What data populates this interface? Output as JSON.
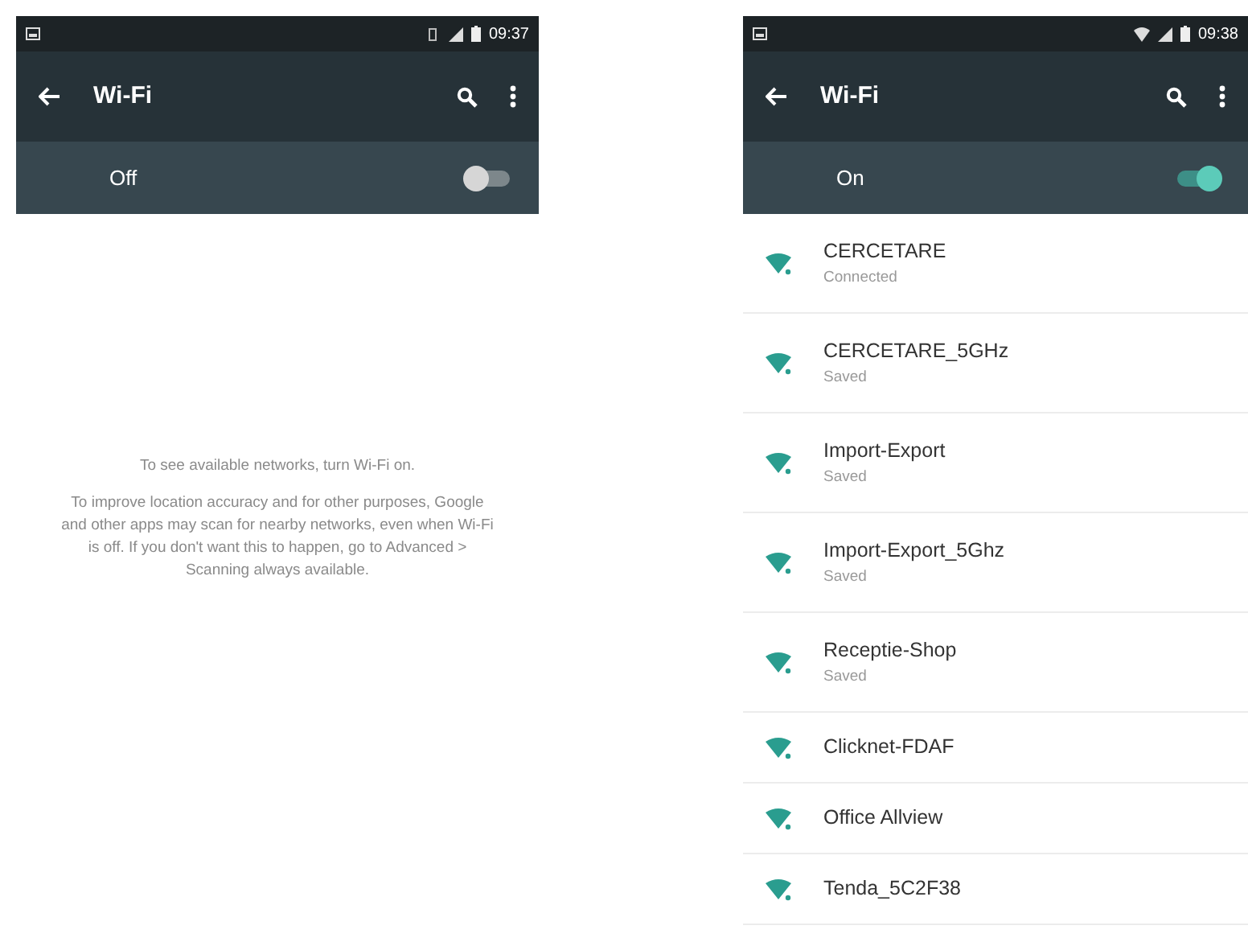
{
  "screens": [
    {
      "status_bar": {
        "time": "09:37"
      },
      "app_bar": {
        "title": "Wi-Fi"
      },
      "master_switch": {
        "label": "Off",
        "on": false
      },
      "messages": [
        "To see available networks, turn Wi-Fi on.",
        "To improve location accuracy and for other purposes, Google and other apps may scan for nearby networks, even when Wi-Fi is off. If you don't want this to happen, go to Advanced > Scanning always available."
      ]
    },
    {
      "status_bar": {
        "time": "09:38"
      },
      "app_bar": {
        "title": "Wi-Fi"
      },
      "master_switch": {
        "label": "On",
        "on": true
      },
      "networks": [
        {
          "name": "CERCETARE",
          "status": "Connected"
        },
        {
          "name": "CERCETARE_5GHz",
          "status": "Saved"
        },
        {
          "name": "Import-Export",
          "status": "Saved"
        },
        {
          "name": "Import-Export_5Ghz",
          "status": "Saved"
        },
        {
          "name": "Receptie-Shop",
          "status": "Saved"
        },
        {
          "name": "Clicknet-FDAF"
        },
        {
          "name": "Office Allview"
        },
        {
          "name": "Tenda_5C2F38"
        }
      ]
    }
  ]
}
